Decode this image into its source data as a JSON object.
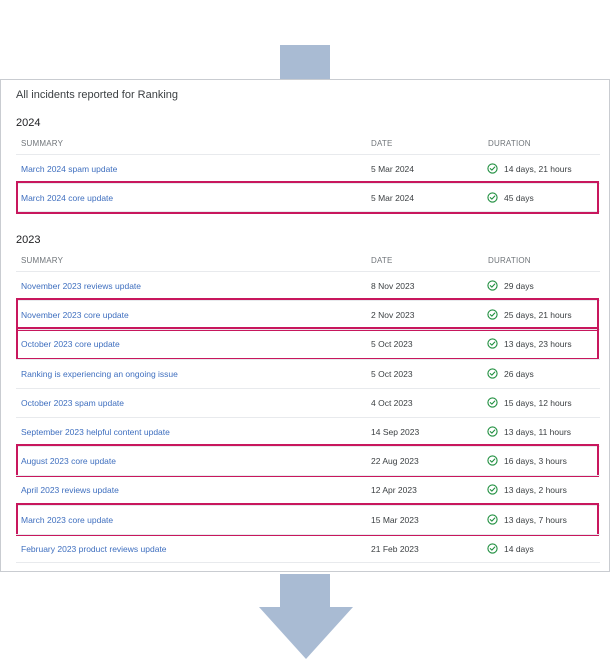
{
  "panel": {
    "title": "All incidents reported for Ranking"
  },
  "columns": {
    "summary": "SUMMARY",
    "date": "DATE",
    "duration": "DURATION"
  },
  "colors": {
    "link": "#3f6fbf",
    "highlight": "#c8175d",
    "ok": "#1e8e3e",
    "arrow": "#a9bbd3"
  },
  "sections": [
    {
      "year": "2024",
      "rows": [
        {
          "summary": "March 2024 spam update",
          "date": "5 Mar 2024",
          "duration": "14 days, 21 hours",
          "highlighted": false
        },
        {
          "summary": "March 2024 core update",
          "date": "5 Mar 2024",
          "duration": "45 days",
          "highlighted": true
        }
      ]
    },
    {
      "year": "2023",
      "rows": [
        {
          "summary": "November 2023 reviews update",
          "date": "8 Nov 2023",
          "duration": "29 days",
          "highlighted": false
        },
        {
          "summary": "November 2023 core update",
          "date": "2 Nov 2023",
          "duration": "25 days, 21 hours",
          "highlighted": true
        },
        {
          "summary": "October 2023 core update",
          "date": "5 Oct 2023",
          "duration": "13 days, 23 hours",
          "highlighted": true
        },
        {
          "summary": "Ranking is experiencing an ongoing issue",
          "date": "5 Oct 2023",
          "duration": "26 days",
          "highlighted": false
        },
        {
          "summary": "October 2023 spam update",
          "date": "4 Oct 2023",
          "duration": "15 days, 12 hours",
          "highlighted": false
        },
        {
          "summary": "September 2023 helpful content update",
          "date": "14 Sep 2023",
          "duration": "13 days, 11 hours",
          "highlighted": false
        },
        {
          "summary": "August 2023 core update",
          "date": "22 Aug 2023",
          "duration": "16 days, 3 hours",
          "highlighted": true
        },
        {
          "summary": "April 2023 reviews update",
          "date": "12 Apr 2023",
          "duration": "13 days, 2 hours",
          "highlighted": false
        },
        {
          "summary": "March 2023 core update",
          "date": "15 Mar 2023",
          "duration": "13 days, 7 hours",
          "highlighted": true
        },
        {
          "summary": "February 2023 product reviews update",
          "date": "21 Feb 2023",
          "duration": "14 days",
          "highlighted": false
        }
      ]
    }
  ]
}
